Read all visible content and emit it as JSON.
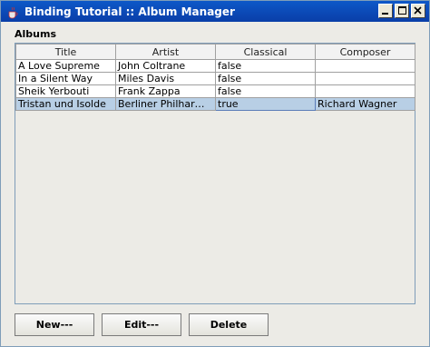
{
  "window": {
    "title": "Binding Tutorial :: Album Manager",
    "controls": {
      "minimize": "_",
      "maximize": "□",
      "close": "×"
    }
  },
  "albums": {
    "label": "Albums",
    "columns": [
      "Title",
      "Artist",
      "Classical",
      "Composer"
    ],
    "rows": [
      [
        "A Love Supreme",
        "John Coltrane",
        "false",
        ""
      ],
      [
        "In a Silent Way",
        "Miles Davis",
        "false",
        ""
      ],
      [
        "Sheik Yerbouti",
        "Frank Zappa",
        "false",
        ""
      ],
      [
        "Tristan und Isolde",
        "Berliner Philharmon...",
        "true",
        "Richard Wagner"
      ]
    ],
    "selected_row": 3
  },
  "buttons": {
    "new": "New---",
    "edit": "Edit---",
    "delete": "Delete"
  },
  "icons": {
    "app": "java-cup-icon"
  },
  "colors": {
    "titlebar": "#0a4fc2",
    "selection": "#b8cfe5"
  }
}
